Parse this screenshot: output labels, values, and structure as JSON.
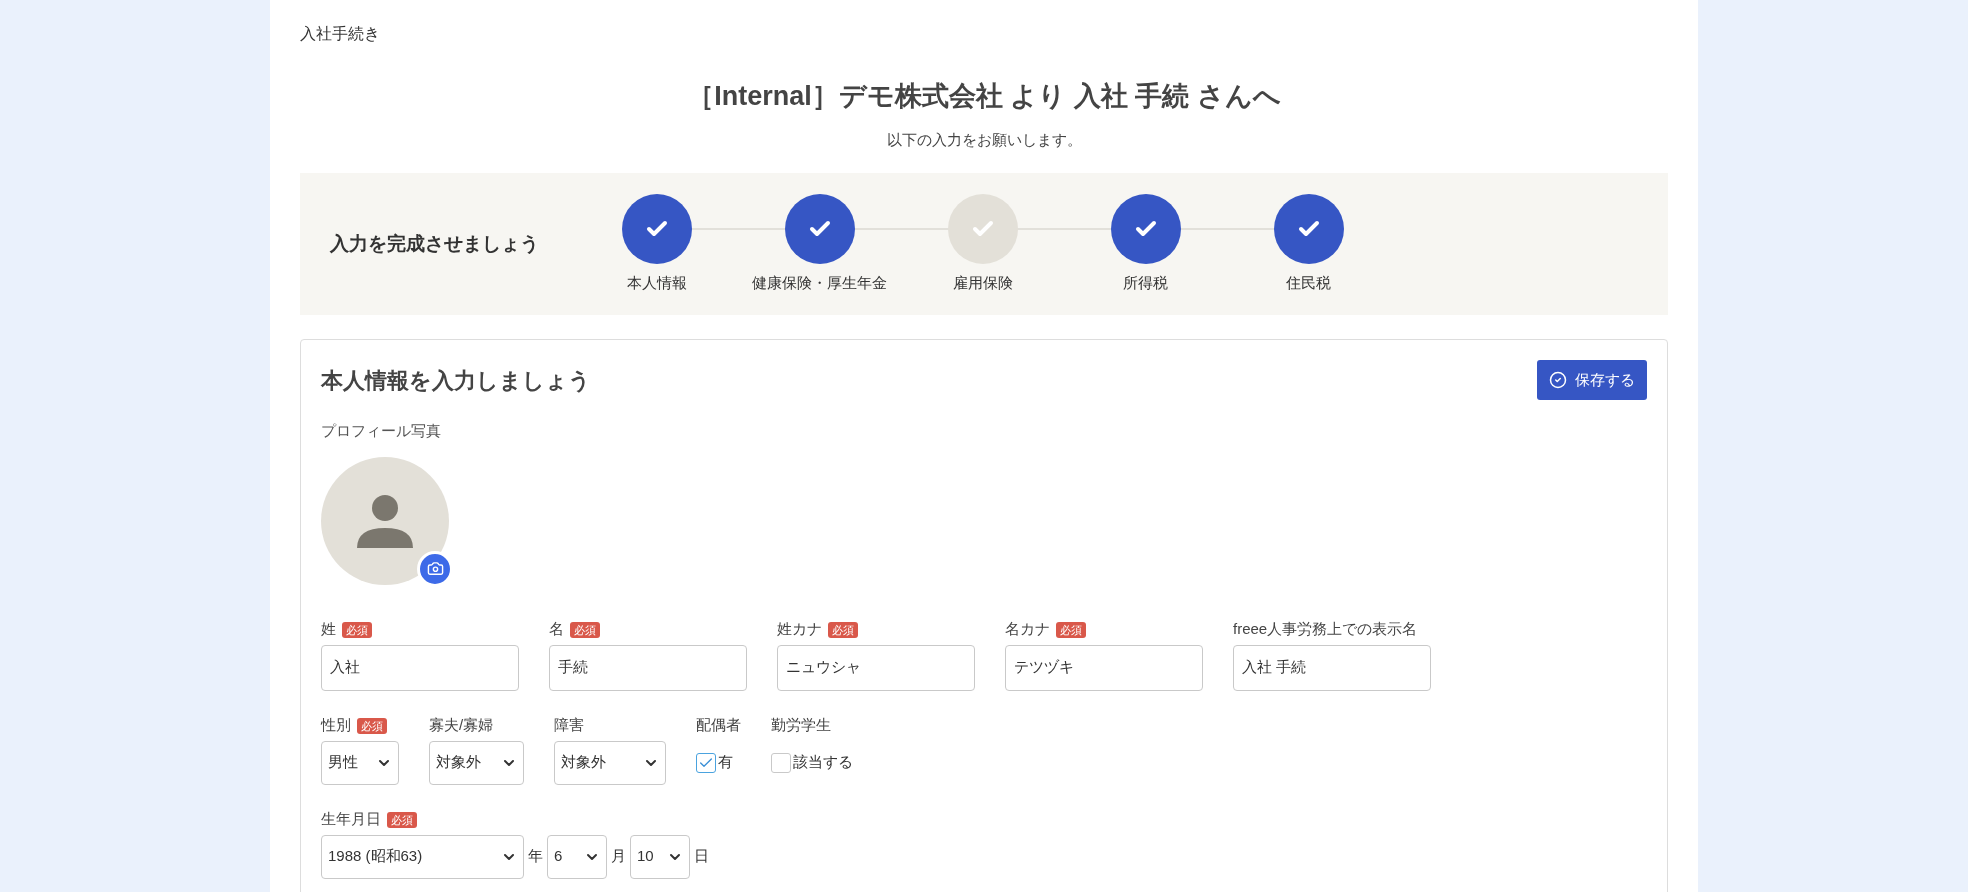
{
  "breadcrumb": "入社手続き",
  "title": "［Internal］デモ株式会社 より 入社 手続 さんへ",
  "subtitle": "以下の入力をお願いします。",
  "progress": {
    "heading": "入力を完成させましょう",
    "steps": [
      {
        "label": "本人情報",
        "done": true
      },
      {
        "label": "健康保険・厚生年金",
        "done": true
      },
      {
        "label": "雇用保険",
        "done": false
      },
      {
        "label": "所得税",
        "done": true
      },
      {
        "label": "住民税",
        "done": true
      }
    ]
  },
  "form": {
    "heading": "本人情報を入力しましょう",
    "save_button": "保存する",
    "photo_label": "プロフィール写真",
    "sections": [
      {
        "fields": [
          {
            "kind": "input",
            "label": "姓",
            "badge": "必須",
            "value": "入社"
          },
          {
            "kind": "input",
            "label": "名",
            "badge": "必須",
            "value": "手続"
          },
          {
            "kind": "input",
            "label": "姓カナ",
            "badge": "必須",
            "value": "ニュウシャ"
          },
          {
            "kind": "input",
            "label": "名カナ",
            "badge": "必須",
            "value": "テツヅキ"
          },
          {
            "kind": "input",
            "label": "freee人事労務上での表示名",
            "value": "入社 手続"
          }
        ]
      },
      {
        "fields": [
          {
            "kind": "select",
            "label": "性別",
            "badge": "必須",
            "value": "男性"
          },
          {
            "kind": "select",
            "label": "寡夫/寡婦",
            "value": "対象外"
          },
          {
            "kind": "select",
            "label": "障害",
            "value": "対象外"
          },
          {
            "kind": "checkbox",
            "label": "配偶者",
            "option": "有",
            "checked": true
          },
          {
            "kind": "checkbox",
            "label": "勤労学生",
            "option": "該当する",
            "checked": false
          }
        ]
      },
      {
        "fields": [
          {
            "kind": "date",
            "label": "生年月日",
            "badge": "必須",
            "parts": [
              {
                "value": "1988 (昭和63)",
                "unit": "年"
              },
              {
                "value": "6",
                "unit": "月"
              },
              {
                "value": "10",
                "unit": "日"
              }
            ]
          }
        ]
      }
    ]
  }
}
